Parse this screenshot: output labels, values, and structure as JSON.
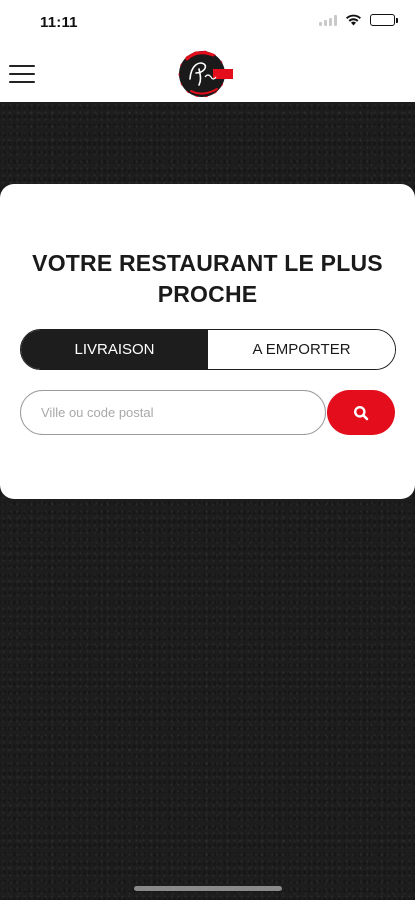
{
  "status_bar": {
    "time": "11:11"
  },
  "header": {
    "menu_icon": "hamburger-menu-icon",
    "logo_icon": "pizza-logo"
  },
  "search_card": {
    "title": "VOTRE RESTAURANT LE PLUS PROCHE",
    "tabs": [
      {
        "label": "LIVRAISON",
        "active": true
      },
      {
        "label": "A EMPORTER",
        "active": false
      }
    ],
    "search": {
      "placeholder": "Ville ou code postal",
      "value": "",
      "button_icon": "search-icon"
    }
  },
  "colors": {
    "accent": "#e30d1c",
    "dark": "#1d1d1e",
    "background": "#ffffff"
  }
}
